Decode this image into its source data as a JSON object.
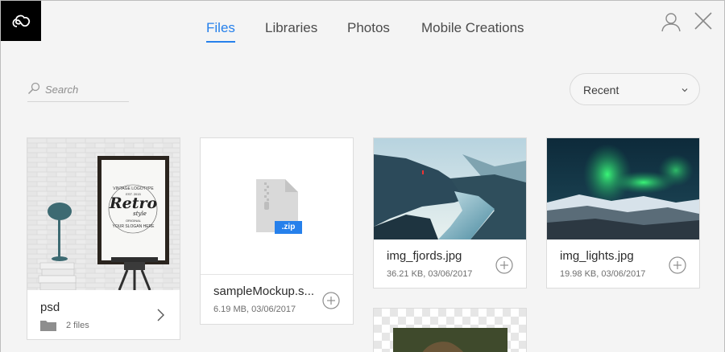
{
  "nav": {
    "tabs": [
      {
        "label": "Files",
        "active": true
      },
      {
        "label": "Libraries",
        "active": false
      },
      {
        "label": "Photos",
        "active": false
      },
      {
        "label": "Mobile Creations",
        "active": false
      }
    ]
  },
  "header": {
    "logo_icon": "creative-cloud-logo-icon",
    "profile_icon": "user-profile-icon",
    "close_icon": "close-icon"
  },
  "search": {
    "placeholder": "Search",
    "value": ""
  },
  "sort": {
    "selected": "Recent"
  },
  "colors": {
    "accent": "#2680eb",
    "background": "#f4f4f4",
    "zip_badge": "#2680eb"
  },
  "files": [
    {
      "name": "psd",
      "type": "folder",
      "meta": "2 files",
      "poster": {
        "line1": "VINTAGE LOGOTYPE",
        "line2": "EST. 2015",
        "line3": "Retro",
        "line4": "style",
        "line5": "ORIGINAL",
        "line6": "YOUR SLOGAN HERE"
      }
    },
    {
      "name": "sampleMockup.s...",
      "type": "zip",
      "badge": ".zip",
      "meta": "6.19 MB, 03/06/2017"
    },
    {
      "name": "img_fjords.jpg",
      "type": "image",
      "meta": "36.21 KB, 03/06/2017"
    },
    {
      "name": "img_lights.jpg",
      "type": "image",
      "meta": "19.98 KB, 03/06/2017"
    },
    {
      "name": "",
      "type": "image",
      "meta": ""
    }
  ]
}
